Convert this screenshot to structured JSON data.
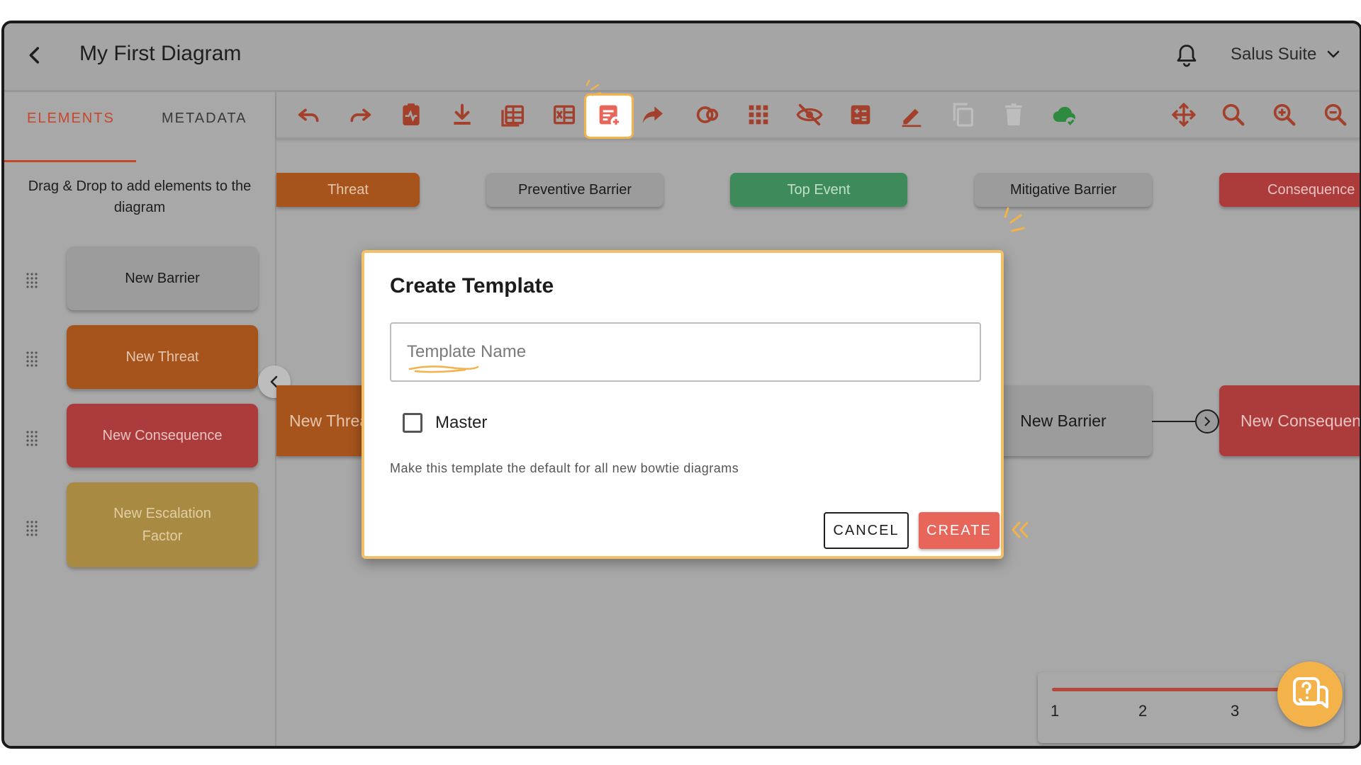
{
  "header": {
    "title": "My First Diagram",
    "org_name": "Salus Suite"
  },
  "sidebar": {
    "tabs": [
      {
        "label": "ELEMENTS",
        "active": true
      },
      {
        "label": "METADATA",
        "active": false
      }
    ],
    "hint": "Drag & Drop to add elements to the diagram",
    "elements": [
      {
        "label": "New Barrier",
        "kind": "barrier"
      },
      {
        "label": "New Threat",
        "kind": "threat"
      },
      {
        "label": "New Consequence",
        "kind": "consequence"
      },
      {
        "label": "New Escalation Factor",
        "kind": "escalation"
      }
    ]
  },
  "toolbar": {
    "icons": [
      "undo-icon",
      "redo-icon",
      "health-report-icon",
      "download-icon",
      "table-view-icon",
      "excel-export-icon",
      "create-template-icon",
      "share-icon",
      "link-icon",
      "grid-icon",
      "hide-icon",
      "calculator-icon",
      "edit-icon",
      "copy-icon",
      "delete-icon",
      "cloud-saved-icon",
      "move-icon",
      "search-icon",
      "zoom-in-icon",
      "zoom-out-icon"
    ],
    "active_icon": "create-template-icon"
  },
  "canvas": {
    "lanes": [
      {
        "label": "Threat"
      },
      {
        "label": "Preventive Barrier"
      },
      {
        "label": "Top Event"
      },
      {
        "label": "Mitigative Barrier"
      },
      {
        "label": "Consequence"
      }
    ],
    "nodes": {
      "threat": "New Threa",
      "barrier": "New Barrier",
      "consequence": "New Consequen"
    }
  },
  "dialog": {
    "title": "Create Template",
    "input_placeholder": "Template Name",
    "input_value": "",
    "checkbox_label": "Master",
    "checkbox_checked": false,
    "description": "Make this template the default for all new bowtie diagrams",
    "cancel_label": "CANCEL",
    "create_label": "CREATE"
  },
  "stepper": {
    "steps": [
      "1",
      "2",
      "3"
    ]
  },
  "colors": {
    "accent": "#c8462b",
    "create_button": "#e8655a",
    "highlight": "#f3b24a",
    "threat": "#a6541c",
    "consequence": "#ac3c3c",
    "top_event": "#3f8a5a",
    "escalation": "#a98a43"
  }
}
